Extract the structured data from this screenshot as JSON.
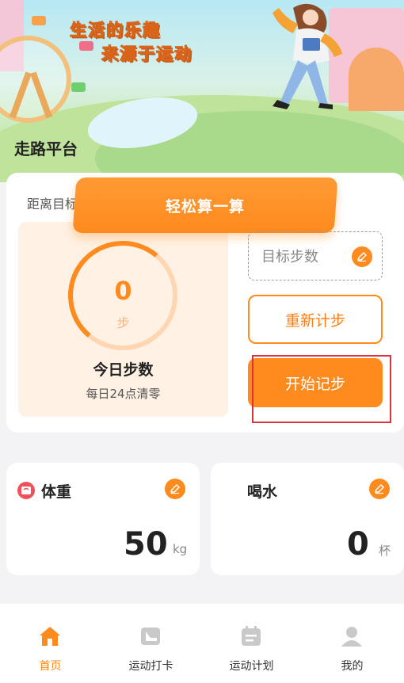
{
  "banner": {
    "slogan_line1": "生活的乐趣",
    "slogan_line2": "来源于运动"
  },
  "page_title": "走路平台",
  "step_card": {
    "target_label": "距离目标",
    "calc_button": "轻松算一算",
    "steps_value": "0",
    "steps_unit": "步",
    "today_label": "今日步数",
    "reset_note": "每日24点清零",
    "goal_placeholder": "目标步数",
    "reset_button": "重新计步",
    "start_button": "开始记步"
  },
  "metrics": {
    "weight": {
      "title": "体重",
      "value": "50",
      "unit": "kg"
    },
    "water": {
      "title": "喝水",
      "value": "0",
      "unit": "杯"
    }
  },
  "nav": {
    "items": [
      {
        "label": "首页",
        "icon": "home-icon",
        "active": true
      },
      {
        "label": "运动打卡",
        "icon": "shoe-checkin-icon",
        "active": false
      },
      {
        "label": "运动计划",
        "icon": "calendar-plan-icon",
        "active": false
      },
      {
        "label": "我的",
        "icon": "user-icon",
        "active": false
      }
    ]
  },
  "colors": {
    "accent": "#ff8b1e",
    "accent_light": "#fff1e4",
    "highlight": "#e0303a"
  }
}
